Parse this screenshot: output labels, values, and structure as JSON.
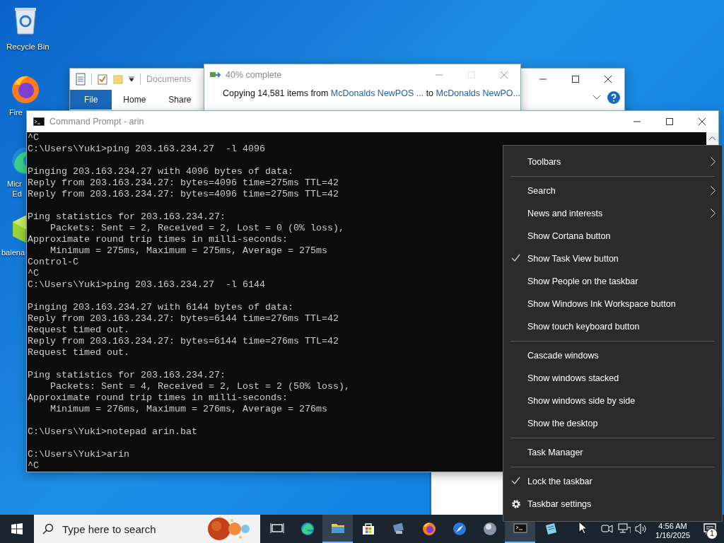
{
  "desktop_icons": [
    {
      "label": [
        "Recycle Bin"
      ],
      "kind": "recycle"
    },
    {
      "label": [
        "Fire"
      ],
      "kind": "firefox"
    },
    {
      "label": [
        "Micr",
        "Ed"
      ],
      "kind": "edge"
    },
    {
      "label": [
        "balena"
      ],
      "kind": "cube"
    }
  ],
  "explorer_window": {
    "title": "Documents",
    "tabs": [
      {
        "label": "File",
        "selected": true
      },
      {
        "label": "Home",
        "selected": false
      },
      {
        "label": "Share",
        "selected": false
      }
    ]
  },
  "copy_dialog": {
    "title": "40% complete",
    "maximize_disabled": true,
    "message": {
      "prefix": "Copying 14,581 items from ",
      "source": "McDonalds NewPOS ...",
      "middle": " to ",
      "destination": "McDonalds NewPO..."
    }
  },
  "command_window": {
    "title": "Command Prompt - arin",
    "blocks": [
      [
        "^C",
        "C:\\Users\\Yuki>ping 203.163.234.27  -l 4096"
      ],
      [
        "Pinging 203.163.234.27 with 4096 bytes of data:",
        "Reply from 203.163.234.27: bytes=4096 time=275ms TTL=42",
        "Reply from 203.163.234.27: bytes=4096 time=275ms TTL=42"
      ],
      [
        "Ping statistics for 203.163.234.27:",
        "    Packets: Sent = 2, Received = 2, Lost = 0 (0% loss),",
        "Approximate round trip times in milli-seconds:",
        "    Minimum = 275ms, Maximum = 275ms, Average = 275ms",
        "Control-C",
        "^C",
        "C:\\Users\\Yuki>ping 203.163.234.27  -l 6144"
      ],
      [
        "Pinging 203.163.234.27 with 6144 bytes of data:",
        "Reply from 203.163.234.27: bytes=6144 time=276ms TTL=42",
        "Request timed out.",
        "Reply from 203.163.234.27: bytes=6144 time=276ms TTL=42",
        "Request timed out."
      ],
      [
        "Ping statistics for 203.163.234.27:",
        "    Packets: Sent = 4, Received = 2, Lost = 2 (50% loss),",
        "Approximate round trip times in milli-seconds:",
        "    Minimum = 276ms, Maximum = 276ms, Average = 276ms"
      ],
      [
        "C:\\Users\\Yuki>notepad arin.bat"
      ],
      [
        "C:\\Users\\Yuki>arin",
        "^C"
      ]
    ]
  },
  "context_menu": {
    "groups": [
      [
        {
          "label": "Toolbars",
          "kind": "option",
          "checked": false,
          "submenu": true
        }
      ],
      [
        {
          "label": "Search",
          "kind": "option",
          "checked": false,
          "submenu": true
        },
        {
          "label": "News and interests",
          "kind": "option",
          "checked": false,
          "submenu": true
        },
        {
          "label": "Show Cortana button",
          "kind": "option",
          "checked": false,
          "submenu": false
        },
        {
          "label": "Show Task View button",
          "kind": "option",
          "checked": true,
          "submenu": false
        },
        {
          "label": "Show People on the taskbar",
          "kind": "option",
          "checked": false,
          "submenu": false
        },
        {
          "label": "Show Windows Ink Workspace button",
          "kind": "option",
          "checked": false,
          "submenu": false
        },
        {
          "label": "Show touch keyboard button",
          "kind": "option",
          "checked": false,
          "submenu": false
        }
      ],
      [
        {
          "label": "Cascade windows",
          "kind": "option",
          "checked": false,
          "submenu": false
        },
        {
          "label": "Show windows stacked",
          "kind": "option",
          "checked": false,
          "submenu": false
        },
        {
          "label": "Show windows side by side",
          "kind": "option",
          "checked": false,
          "submenu": false
        },
        {
          "label": "Show the desktop",
          "kind": "option",
          "checked": false,
          "submenu": false
        }
      ],
      [
        {
          "label": "Task Manager",
          "kind": "option",
          "checked": false,
          "submenu": false
        }
      ],
      [
        {
          "label": "Lock the taskbar",
          "kind": "option",
          "checked": true,
          "submenu": false
        },
        {
          "label": "Taskbar settings",
          "kind": "settings",
          "checked": false,
          "submenu": false
        }
      ]
    ]
  },
  "taskbar": {
    "search": {
      "placeholder": "Type here to search"
    },
    "apps": [
      {
        "kind": "task-view",
        "active": false
      },
      {
        "kind": "edge",
        "active": false
      },
      {
        "kind": "folder",
        "active": true
      },
      {
        "kind": "store",
        "active": false
      },
      {
        "kind": "computer",
        "active": false
      },
      {
        "kind": "firefox",
        "active": false
      },
      {
        "kind": "compass",
        "active": false
      },
      {
        "kind": "sphere",
        "active": false
      },
      {
        "kind": "terminal",
        "active": true
      },
      {
        "kind": "notepad",
        "active": false
      }
    ],
    "time": "4:56 AM",
    "date": "1/16/2025",
    "notification_count": "1"
  }
}
